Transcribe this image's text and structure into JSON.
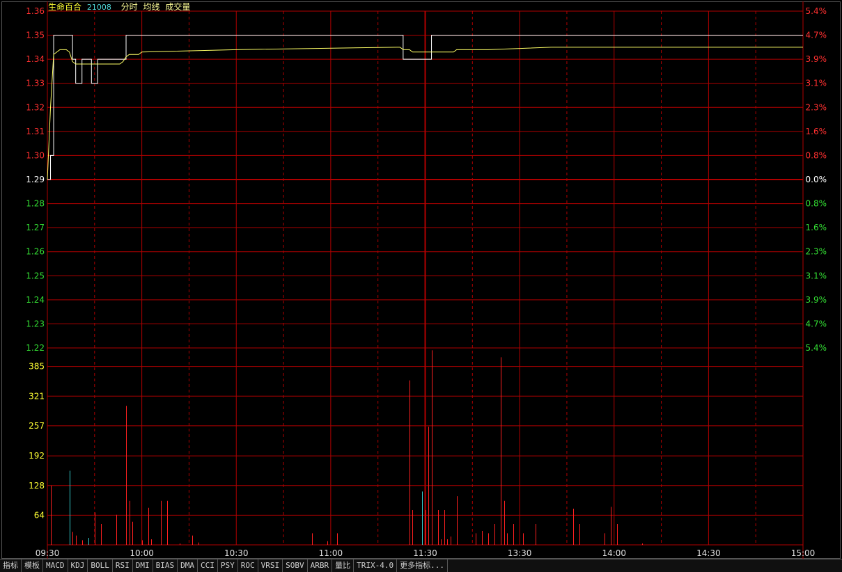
{
  "header": {
    "stock_name": "生命百合",
    "stock_code": "21008",
    "indicator_labels": [
      "分时",
      "均线",
      "成交量"
    ]
  },
  "tabs": [
    "指标",
    "模板",
    "MACD",
    "KDJ",
    "BOLL",
    "RSI",
    "DMI",
    "BIAS",
    "DMA",
    "CCI",
    "PSY",
    "ROC",
    "VRSI",
    "SOBV",
    "ARBR",
    "量比",
    "TRIX-4.0",
    "更多指标..."
  ],
  "colors": {
    "background": "#000000",
    "grid": "#b00000",
    "price_line": "#ffffff",
    "avg_line": "#ffff66",
    "up_tick": "#ff3030",
    "flat_tick": "#ffffff",
    "down_tick": "#33dd33",
    "volume_up": "#ff2020",
    "volume_down": "#33cccc",
    "axis_vol": "#ffff33"
  },
  "chart_data": [
    {
      "type": "line",
      "title": "",
      "prev_close": 1.29,
      "ylim": [
        1.22,
        1.36
      ],
      "y_ticks": [
        "1.36",
        "1.35",
        "1.34",
        "1.33",
        "1.32",
        "1.31",
        "1.30",
        "1.29",
        "1.28",
        "1.27",
        "1.26",
        "1.25",
        "1.24",
        "1.23",
        "1.22"
      ],
      "pct_ticks": [
        "5.4%",
        "4.7%",
        "3.9%",
        "3.1%",
        "2.3%",
        "1.6%",
        "0.8%",
        "0.0%",
        "0.8%",
        "1.6%",
        "2.3%",
        "3.1%",
        "3.9%",
        "4.7%",
        "5.4%"
      ],
      "x_ticks": [
        "09:30",
        "10:00",
        "10:30",
        "11:00",
        "11:30",
        "13:30",
        "14:00",
        "14:30",
        "15:00"
      ],
      "x": [
        0,
        1,
        2,
        3,
        4,
        5,
        6,
        7,
        8,
        9,
        10,
        11,
        12,
        13,
        14,
        15,
        16,
        17,
        18,
        19,
        20,
        21,
        22,
        23,
        24,
        25,
        26,
        27,
        28,
        29,
        30,
        60,
        111,
        112,
        113,
        114,
        115,
        116,
        117,
        118,
        119,
        120,
        121,
        122,
        123,
        124,
        125,
        126,
        127,
        128,
        129,
        130,
        140,
        160,
        200,
        240
      ],
      "series": [
        {
          "key": "price",
          "values": [
            1.29,
            1.3,
            1.35,
            1.35,
            1.35,
            1.35,
            1.35,
            1.35,
            1.34,
            1.33,
            1.33,
            1.34,
            1.34,
            1.34,
            1.33,
            1.33,
            1.34,
            1.34,
            1.34,
            1.34,
            1.34,
            1.34,
            1.34,
            1.34,
            1.34,
            1.35,
            1.35,
            1.35,
            1.35,
            1.35,
            1.35,
            1.35,
            1.35,
            1.35,
            1.34,
            1.34,
            1.34,
            1.34,
            1.34,
            1.34,
            1.34,
            1.34,
            1.34,
            1.35,
            1.35,
            1.35,
            1.35,
            1.35,
            1.35,
            1.35,
            1.35,
            1.35,
            1.35,
            1.35,
            1.35,
            1.35
          ]
        },
        {
          "key": "average",
          "values": [
            1.29,
            1.32,
            1.342,
            1.343,
            1.344,
            1.344,
            1.344,
            1.343,
            1.339,
            1.338,
            1.338,
            1.338,
            1.338,
            1.338,
            1.338,
            1.338,
            1.338,
            1.338,
            1.338,
            1.338,
            1.338,
            1.338,
            1.338,
            1.338,
            1.339,
            1.341,
            1.342,
            1.342,
            1.342,
            1.342,
            1.343,
            1.344,
            1.345,
            1.345,
            1.344,
            1.344,
            1.344,
            1.343,
            1.343,
            1.343,
            1.343,
            1.343,
            1.343,
            1.343,
            1.343,
            1.343,
            1.343,
            1.343,
            1.343,
            1.343,
            1.343,
            1.344,
            1.344,
            1.345,
            1.345,
            1.345
          ]
        }
      ]
    },
    {
      "type": "bar",
      "title": "",
      "ylim": [
        0,
        425
      ],
      "y_ticks": [
        "385",
        "321",
        "257",
        "192",
        "128",
        "64"
      ],
      "bars": [
        {
          "x": 1,
          "v": 128,
          "d": "up"
        },
        {
          "x": 7,
          "v": 160,
          "d": "down"
        },
        {
          "x": 8,
          "v": 28,
          "d": "up"
        },
        {
          "x": 9,
          "v": 20,
          "d": "up"
        },
        {
          "x": 11,
          "v": 10,
          "d": "up"
        },
        {
          "x": 13,
          "v": 15,
          "d": "down"
        },
        {
          "x": 15,
          "v": 70,
          "d": "up"
        },
        {
          "x": 17,
          "v": 45,
          "d": "up"
        },
        {
          "x": 22,
          "v": 65,
          "d": "up"
        },
        {
          "x": 25,
          "v": 300,
          "d": "up"
        },
        {
          "x": 26,
          "v": 95,
          "d": "up"
        },
        {
          "x": 27,
          "v": 50,
          "d": "up"
        },
        {
          "x": 30,
          "v": 10,
          "d": "up"
        },
        {
          "x": 32,
          "v": 80,
          "d": "up"
        },
        {
          "x": 33,
          "v": 12,
          "d": "up"
        },
        {
          "x": 36,
          "v": 95,
          "d": "up"
        },
        {
          "x": 38,
          "v": 95,
          "d": "up"
        },
        {
          "x": 42,
          "v": 3,
          "d": "up"
        },
        {
          "x": 46,
          "v": 20,
          "d": "up"
        },
        {
          "x": 48,
          "v": 5,
          "d": "up"
        },
        {
          "x": 84,
          "v": 25,
          "d": "up"
        },
        {
          "x": 89,
          "v": 8,
          "d": "up"
        },
        {
          "x": 92,
          "v": 25,
          "d": "up"
        },
        {
          "x": 115,
          "v": 355,
          "d": "up"
        },
        {
          "x": 116,
          "v": 75,
          "d": "up"
        },
        {
          "x": 119,
          "v": 115,
          "d": "down"
        },
        {
          "x": 120,
          "v": 75,
          "d": "up"
        },
        {
          "x": 121,
          "v": 255,
          "d": "up"
        },
        {
          "x": 122,
          "v": 420,
          "d": "up"
        },
        {
          "x": 124,
          "v": 75,
          "d": "up"
        },
        {
          "x": 125,
          "v": 12,
          "d": "up"
        },
        {
          "x": 126,
          "v": 75,
          "d": "up"
        },
        {
          "x": 127,
          "v": 12,
          "d": "up"
        },
        {
          "x": 128,
          "v": 18,
          "d": "up"
        },
        {
          "x": 130,
          "v": 105,
          "d": "up"
        },
        {
          "x": 136,
          "v": 25,
          "d": "up"
        },
        {
          "x": 138,
          "v": 30,
          "d": "up"
        },
        {
          "x": 140,
          "v": 25,
          "d": "up"
        },
        {
          "x": 142,
          "v": 45,
          "d": "up"
        },
        {
          "x": 144,
          "v": 405,
          "d": "up"
        },
        {
          "x": 145,
          "v": 95,
          "d": "up"
        },
        {
          "x": 146,
          "v": 25,
          "d": "up"
        },
        {
          "x": 148,
          "v": 45,
          "d": "up"
        },
        {
          "x": 151,
          "v": 25,
          "d": "up"
        },
        {
          "x": 155,
          "v": 45,
          "d": "up"
        },
        {
          "x": 167,
          "v": 78,
          "d": "up"
        },
        {
          "x": 169,
          "v": 45,
          "d": "up"
        },
        {
          "x": 177,
          "v": 25,
          "d": "up"
        },
        {
          "x": 179,
          "v": 82,
          "d": "up"
        },
        {
          "x": 181,
          "v": 45,
          "d": "up"
        },
        {
          "x": 189,
          "v": 3,
          "d": "up"
        }
      ]
    }
  ]
}
